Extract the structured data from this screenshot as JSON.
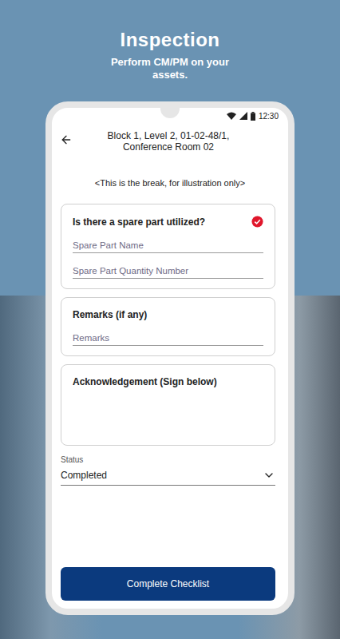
{
  "header": {
    "title": "Inspection",
    "subtitle": "Perform CM/PM on your assets."
  },
  "status_bar": {
    "time": "12:30"
  },
  "screen": {
    "title_lines": [
      "Block 1, Level 2, 01-02-48/1,",
      "Conference Room 02"
    ],
    "note": "<This is the break, for illustration only>"
  },
  "cards": [
    {
      "kind": "question",
      "title": "Is there a spare part utilized?",
      "checked": true,
      "fields": [
        {
          "placeholder": "Spare Part Name"
        },
        {
          "placeholder": "Spare Part Quantity Number"
        }
      ]
    },
    {
      "kind": "fields",
      "title": "Remarks (if any)",
      "fields": [
        {
          "placeholder": "Remarks"
        }
      ]
    },
    {
      "kind": "signature",
      "title": "Acknowledgement (Sign below)"
    }
  ],
  "status": {
    "label": "Status",
    "value": "Completed"
  },
  "button": "Complete Checklist"
}
